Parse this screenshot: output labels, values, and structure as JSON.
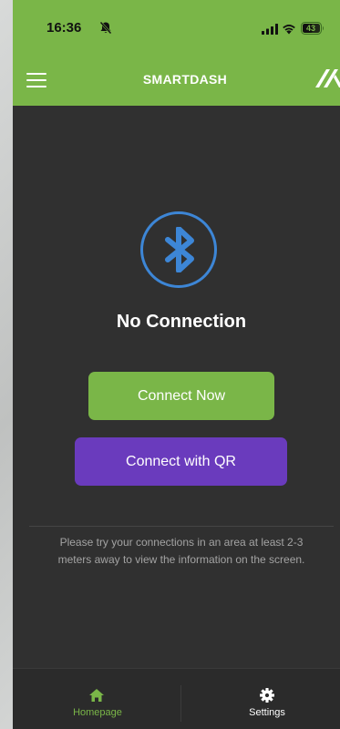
{
  "status_bar": {
    "time": "16:36",
    "battery": "43"
  },
  "app_bar": {
    "title": "SMARTDASH"
  },
  "main": {
    "connection_status": "No Connection",
    "connect_now_label": "Connect Now",
    "connect_qr_label": "Connect with QR",
    "hint_text": "Please try your connections in an area at least 2-3 meters away to view the information on the screen."
  },
  "bottom_nav": {
    "items": [
      {
        "label": "Homepage",
        "icon": "home-icon",
        "active": true
      },
      {
        "label": "Settings",
        "icon": "gear-icon",
        "active": false
      }
    ]
  },
  "colors": {
    "accent_green": "#7ab648",
    "qr_purple": "#6a3bbd",
    "bluetooth_blue": "#3d86d6",
    "background": "#303030"
  }
}
